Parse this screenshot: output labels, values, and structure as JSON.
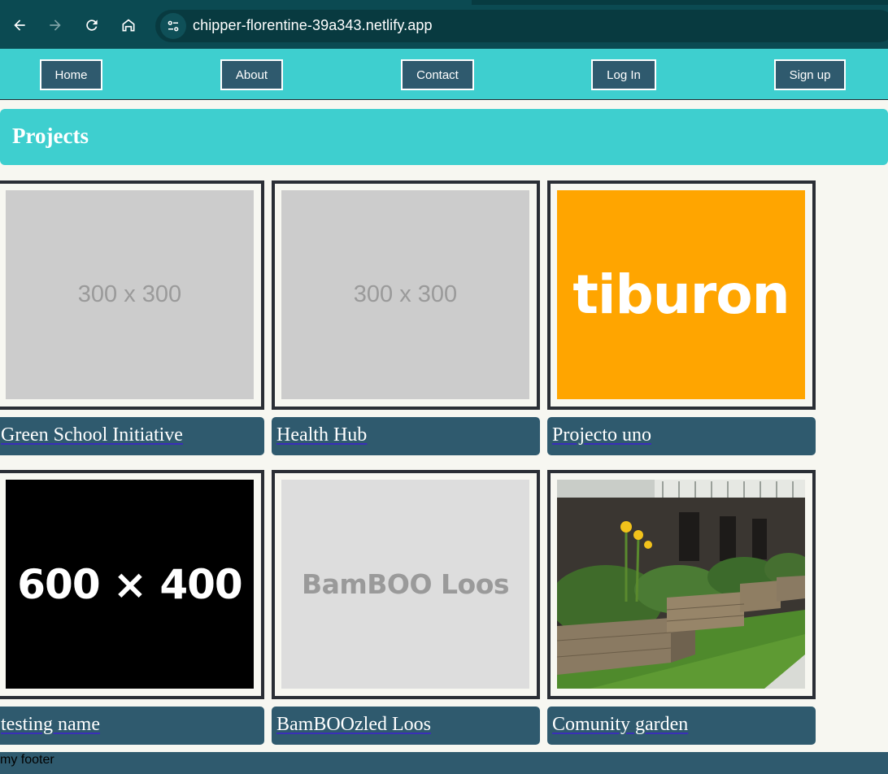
{
  "browser": {
    "url": "chipper-florentine-39a343.netlify.app",
    "icons": [
      "back-arrow-icon",
      "forward-arrow-icon",
      "reload-icon",
      "home-icon",
      "site-settings-icon"
    ]
  },
  "nav": {
    "items": [
      {
        "label": "Home"
      },
      {
        "label": "About"
      },
      {
        "label": "Contact"
      },
      {
        "label": "Log In"
      },
      {
        "label": "Sign up"
      }
    ]
  },
  "page": {
    "heading": "Projects"
  },
  "projects": [
    {
      "title": "Green School Initiative",
      "image_text": "300 x 300"
    },
    {
      "title": "Health Hub",
      "image_text": "300 x 300"
    },
    {
      "title": "Projecto uno",
      "image_text": "tiburon"
    },
    {
      "title": "testing name",
      "image_text": "600 × 400"
    },
    {
      "title": "BamBOOzled Loos",
      "image_text": "BamBOO Loos"
    },
    {
      "title": "Comunity garden",
      "image_text": ""
    }
  ],
  "footer": {
    "text": "my footer"
  },
  "colors": {
    "chrome": "#0b4a52",
    "nav_bg": "#3ecfcf",
    "button_bg": "#2f5a6e",
    "page_bg": "#f7f7f1",
    "orange": "#ffa500"
  }
}
